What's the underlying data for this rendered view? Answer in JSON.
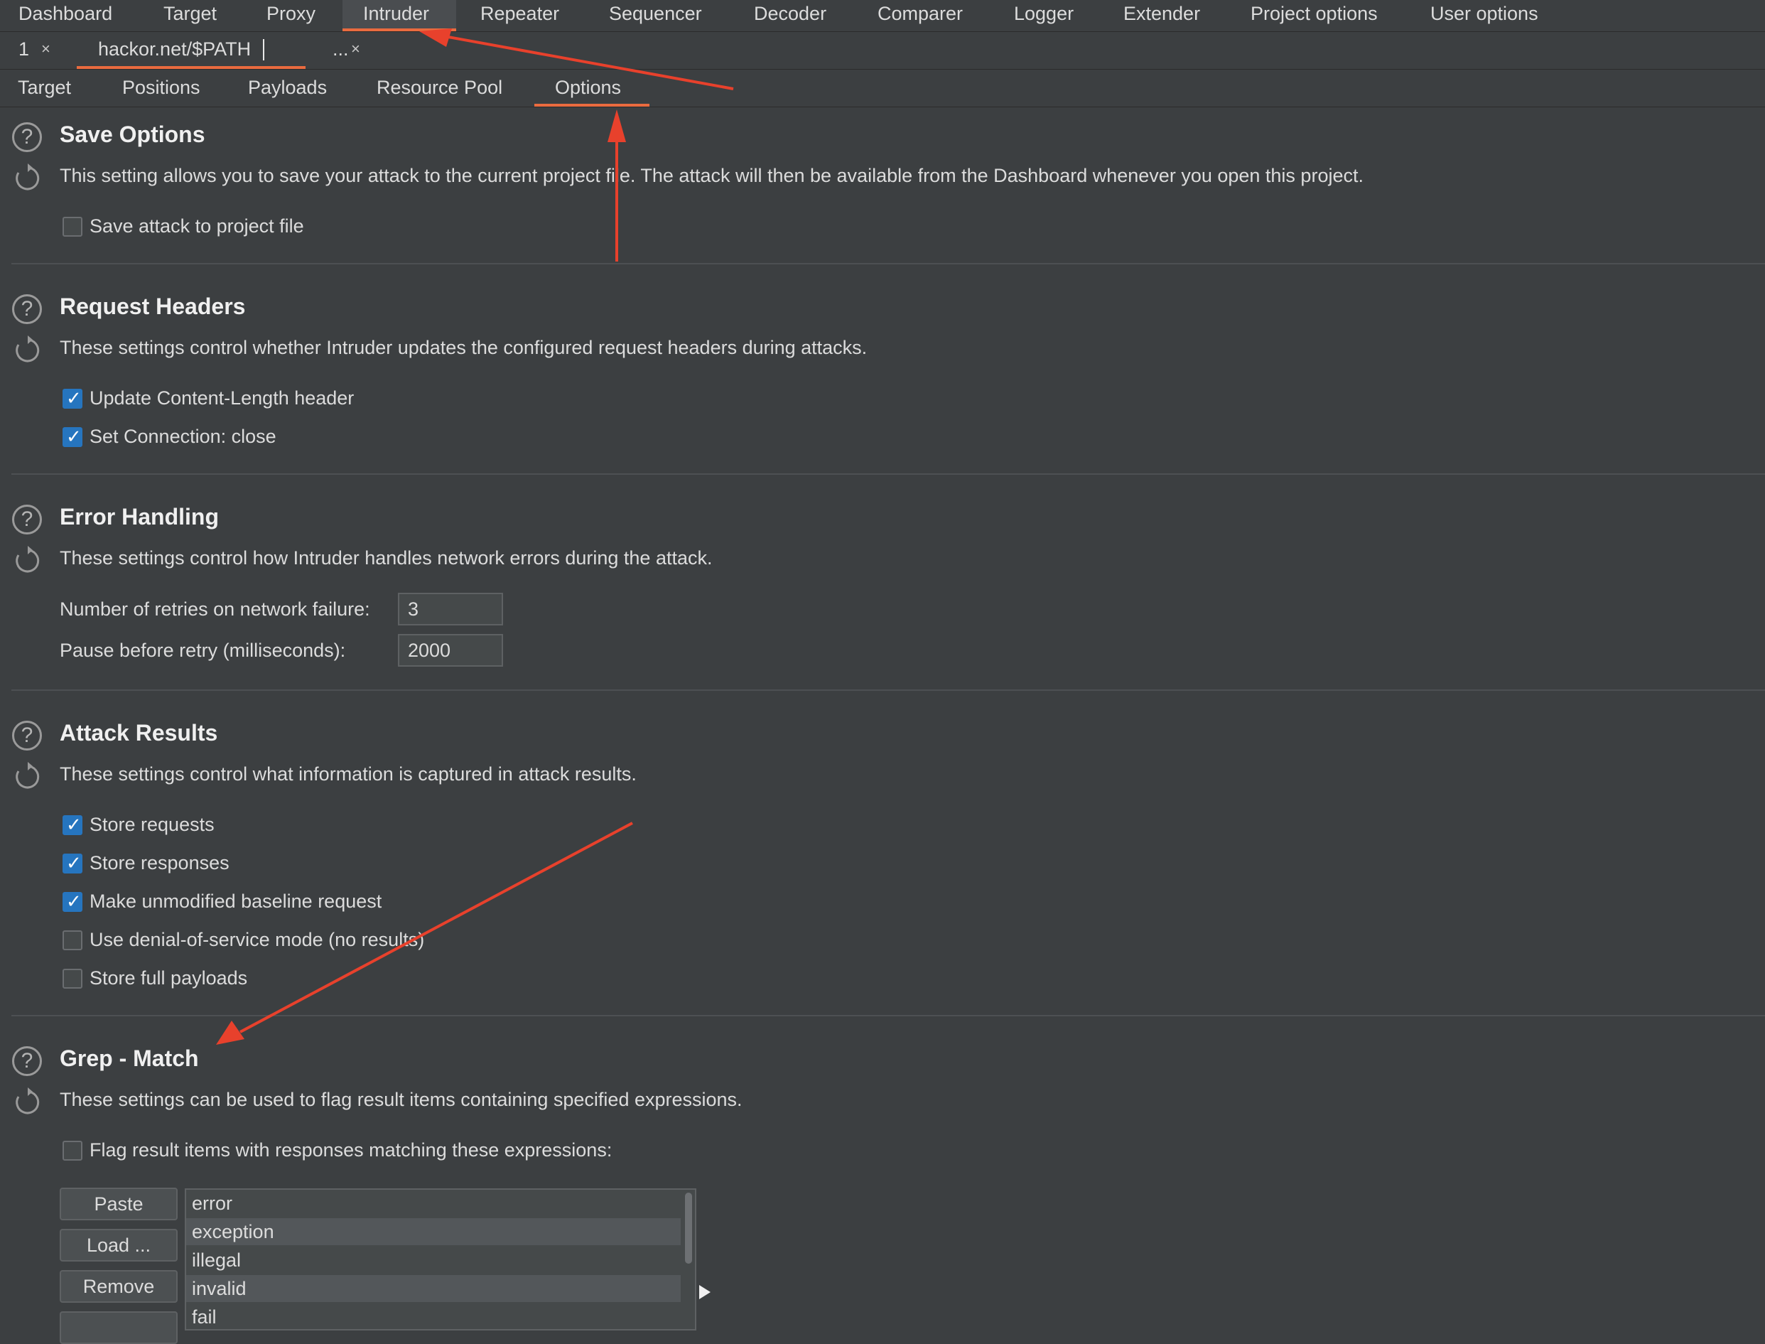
{
  "top_tabs": [
    {
      "label": "Dashboard"
    },
    {
      "label": "Target"
    },
    {
      "label": "Proxy"
    },
    {
      "label": "Intruder",
      "active": true
    },
    {
      "label": "Repeater"
    },
    {
      "label": "Sequencer"
    },
    {
      "label": "Decoder"
    },
    {
      "label": "Comparer"
    },
    {
      "label": "Logger"
    },
    {
      "label": "Extender"
    },
    {
      "label": "Project options"
    },
    {
      "label": "User options"
    }
  ],
  "attack_tabs": {
    "tab1_label": "1",
    "tab2_label": "hackor.net/$PATH",
    "close_symbol": "×",
    "more_label": "..."
  },
  "sub_tabs": [
    {
      "label": "Target"
    },
    {
      "label": "Positions"
    },
    {
      "label": "Payloads"
    },
    {
      "label": "Resource Pool"
    },
    {
      "label": "Options",
      "active": true
    }
  ],
  "help_symbol": "?",
  "sections": {
    "save_options": {
      "title": "Save Options",
      "description": "This setting allows you to save your attack to the current project file. The attack will then be available from the Dashboard whenever you open this project.",
      "checkboxes": [
        {
          "label": "Save attack to project file",
          "checked": false
        }
      ]
    },
    "request_headers": {
      "title": "Request Headers",
      "description": "These settings control whether Intruder updates the configured request headers during attacks.",
      "checkboxes": [
        {
          "label": "Update Content-Length header",
          "checked": true
        },
        {
          "label": "Set Connection: close",
          "checked": true
        }
      ]
    },
    "error_handling": {
      "title": "Error Handling",
      "description": "These settings control how Intruder handles network errors during the attack.",
      "retries_label": "Number of retries on network failure:",
      "retries_value": "3",
      "pause_label": "Pause before retry (milliseconds):",
      "pause_value": "2000"
    },
    "attack_results": {
      "title": "Attack Results",
      "description": "These settings control what information is captured in attack results.",
      "checkboxes": [
        {
          "label": "Store requests",
          "checked": true
        },
        {
          "label": "Store responses",
          "checked": true
        },
        {
          "label": "Make unmodified baseline request",
          "checked": true
        },
        {
          "label": "Use denial-of-service mode (no results)",
          "checked": false
        },
        {
          "label": "Store full payloads",
          "checked": false
        }
      ]
    },
    "grep_match": {
      "title": "Grep - Match",
      "description": "These settings can be used to flag result items containing specified expressions.",
      "flag_label": "Flag result items with responses matching these expressions:",
      "flag_checked": false,
      "buttons": {
        "paste": "Paste",
        "load": "Load ...",
        "remove": "Remove"
      },
      "items": [
        "error",
        "exception",
        "illegal",
        "invalid",
        "fail"
      ]
    }
  },
  "colors": {
    "background": "#3c3f41",
    "accent": "#ea6b3f",
    "checkbox_checked": "#2675bf",
    "annotation_arrow": "#e8412c"
  }
}
